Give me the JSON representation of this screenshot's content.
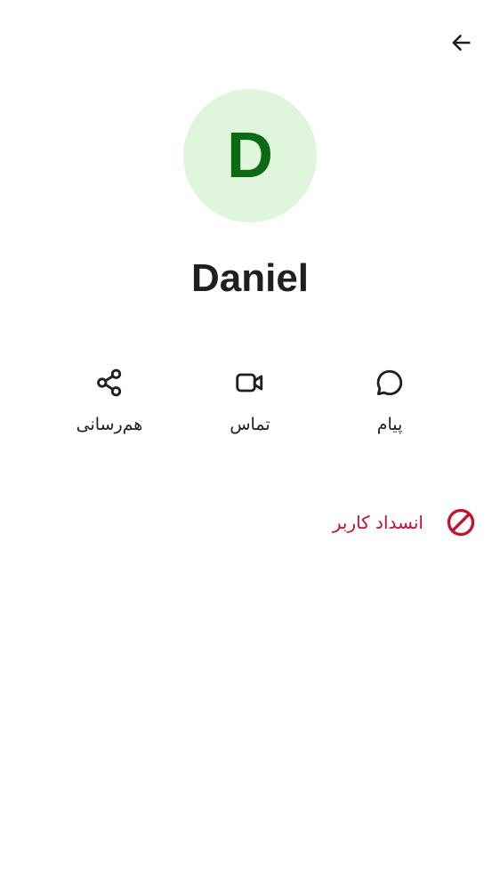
{
  "header": {
    "back_icon": "arrow-back-icon"
  },
  "profile": {
    "avatar_letter": "D",
    "avatar_bg_color": "#dff5dc",
    "avatar_letter_color": "#0a6b12",
    "name": "Daniel"
  },
  "actions": [
    {
      "label": "پیام",
      "icon": "chat-bubble-icon"
    },
    {
      "label": "تماس",
      "icon": "video-camera-icon"
    },
    {
      "label": "هم‌رسانی",
      "icon": "share-icon"
    }
  ],
  "block": {
    "label": "انسداد کاربر",
    "icon": "block-icon",
    "color": "#c8102e"
  }
}
